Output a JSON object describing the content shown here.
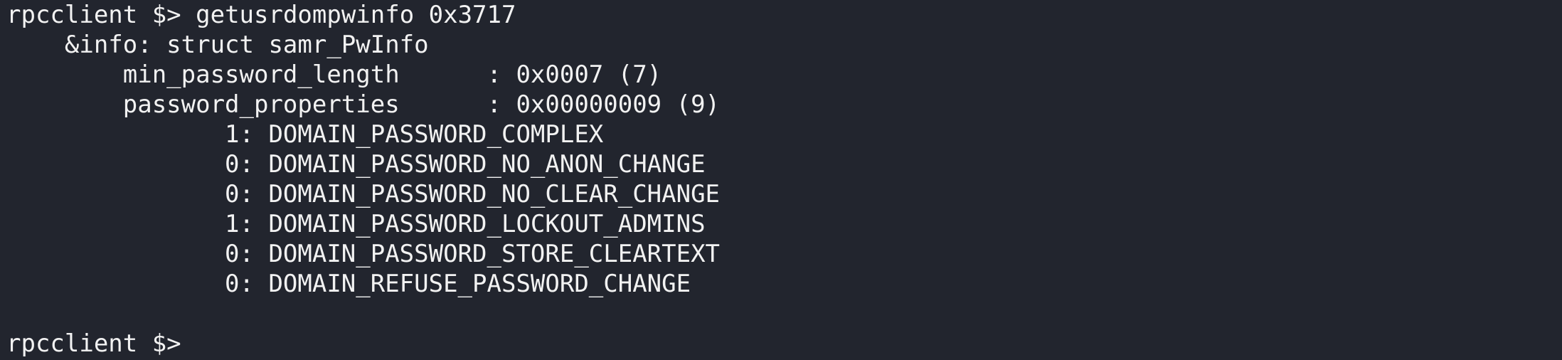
{
  "terminal": {
    "prompt": "rpcclient $>",
    "command": "getusrdompwinfo 0x3717",
    "lines": [
      "    &info: struct samr_PwInfo",
      "        min_password_length      : 0x0007 (7)",
      "        password_properties      : 0x00000009 (9)",
      "               1: DOMAIN_PASSWORD_COMPLEX",
      "               0: DOMAIN_PASSWORD_NO_ANON_CHANGE",
      "               0: DOMAIN_PASSWORD_NO_CLEAR_CHANGE",
      "               1: DOMAIN_PASSWORD_LOCKOUT_ADMINS",
      "               0: DOMAIN_PASSWORD_STORE_CLEARTEXT",
      "               0: DOMAIN_REFUSE_PASSWORD_CHANGE"
    ],
    "final_prompt": "rpcclient $>"
  }
}
